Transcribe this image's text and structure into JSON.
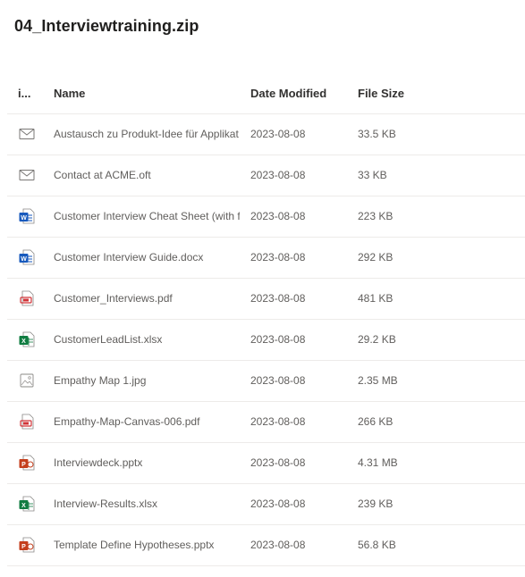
{
  "title": "04_Interviewtraining.zip",
  "columns": {
    "icon": "i...",
    "name": "Name",
    "date": "Date Modified",
    "size": "File Size"
  },
  "files": [
    {
      "icon": "mail-icon",
      "name": "Austausch zu Produkt-Idee für Applikat",
      "date": "2023-08-08",
      "size": "33.5 KB"
    },
    {
      "icon": "mail-icon",
      "name": "Contact at ACME.oft",
      "date": "2023-08-08",
      "size": "33 KB"
    },
    {
      "icon": "word-icon",
      "name": "Customer Interview Cheat Sheet (with fe",
      "date": "2023-08-08",
      "size": "223 KB"
    },
    {
      "icon": "word-icon",
      "name": "Customer Interview Guide.docx",
      "date": "2023-08-08",
      "size": "292 KB"
    },
    {
      "icon": "pdf-icon",
      "name": "Customer_Interviews.pdf",
      "date": "2023-08-08",
      "size": "481 KB"
    },
    {
      "icon": "excel-icon",
      "name": "CustomerLeadList.xlsx",
      "date": "2023-08-08",
      "size": "29.2 KB"
    },
    {
      "icon": "image-icon",
      "name": "Empathy Map 1.jpg",
      "date": "2023-08-08",
      "size": "2.35 MB"
    },
    {
      "icon": "pdf-icon",
      "name": "Empathy-Map-Canvas-006.pdf",
      "date": "2023-08-08",
      "size": "266 KB"
    },
    {
      "icon": "powerpoint-icon",
      "name": "Interviewdeck.pptx",
      "date": "2023-08-08",
      "size": "4.31 MB"
    },
    {
      "icon": "excel-icon",
      "name": "Interview-Results.xlsx",
      "date": "2023-08-08",
      "size": "239 KB"
    },
    {
      "icon": "powerpoint-icon",
      "name": "Template Define Hypotheses.pptx",
      "date": "2023-08-08",
      "size": "56.8 KB"
    }
  ],
  "colors": {
    "word": "#185abd",
    "excel": "#107c41",
    "powerpoint": "#c43e1c",
    "pdf": "#d13438",
    "mail": "#797775",
    "image": "#8a8886"
  }
}
